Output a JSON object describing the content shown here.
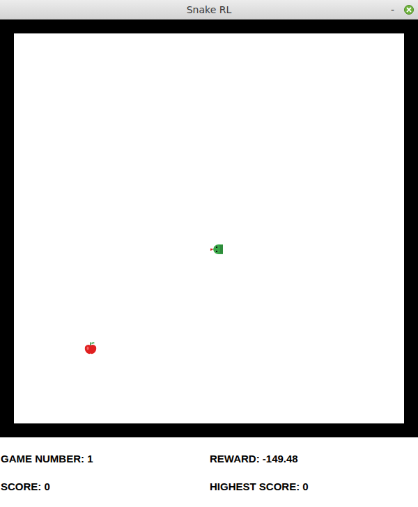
{
  "window": {
    "title": "Snake RL",
    "minimize": "-"
  },
  "game": {
    "snake": {
      "direction": "left"
    }
  },
  "stats": [
    "GAME NUMBER: 1",
    "REWARD: -149.48",
    "SCORE: 0",
    "HIGHEST SCORE: 0"
  ]
}
